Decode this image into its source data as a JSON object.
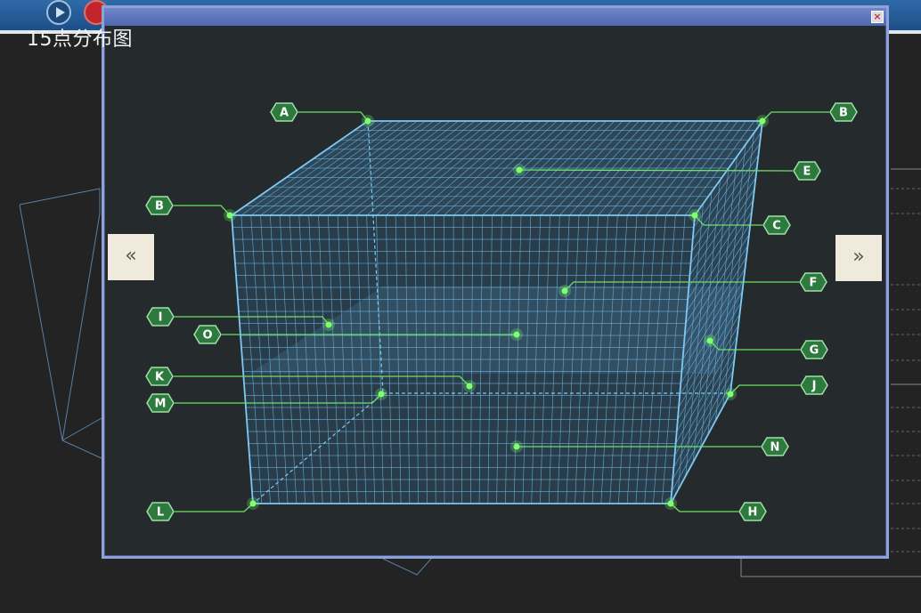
{
  "dialog": {
    "title": "15点分布图",
    "prev_label": "«",
    "next_label": "»",
    "close_label": "×"
  },
  "colors": {
    "grid": "#6fb8e8",
    "edge": "#7ec9f5",
    "fill": "#3b7fb0",
    "point": "#7dff6e",
    "label_bg": "#2e7a3e",
    "label_border": "#9fe0a8",
    "leader": "#6ee06a"
  },
  "points": [
    {
      "id": "A",
      "label": "A"
    },
    {
      "id": "B1",
      "label": "B"
    },
    {
      "id": "B2",
      "label": "B"
    },
    {
      "id": "E",
      "label": "E"
    },
    {
      "id": "C",
      "label": "C"
    },
    {
      "id": "F",
      "label": "F"
    },
    {
      "id": "I",
      "label": "I"
    },
    {
      "id": "O",
      "label": "O"
    },
    {
      "id": "G",
      "label": "G"
    },
    {
      "id": "K",
      "label": "K"
    },
    {
      "id": "J",
      "label": "J"
    },
    {
      "id": "M",
      "label": "M"
    },
    {
      "id": "N",
      "label": "N"
    },
    {
      "id": "L",
      "label": "L"
    },
    {
      "id": "H",
      "label": "H"
    }
  ]
}
